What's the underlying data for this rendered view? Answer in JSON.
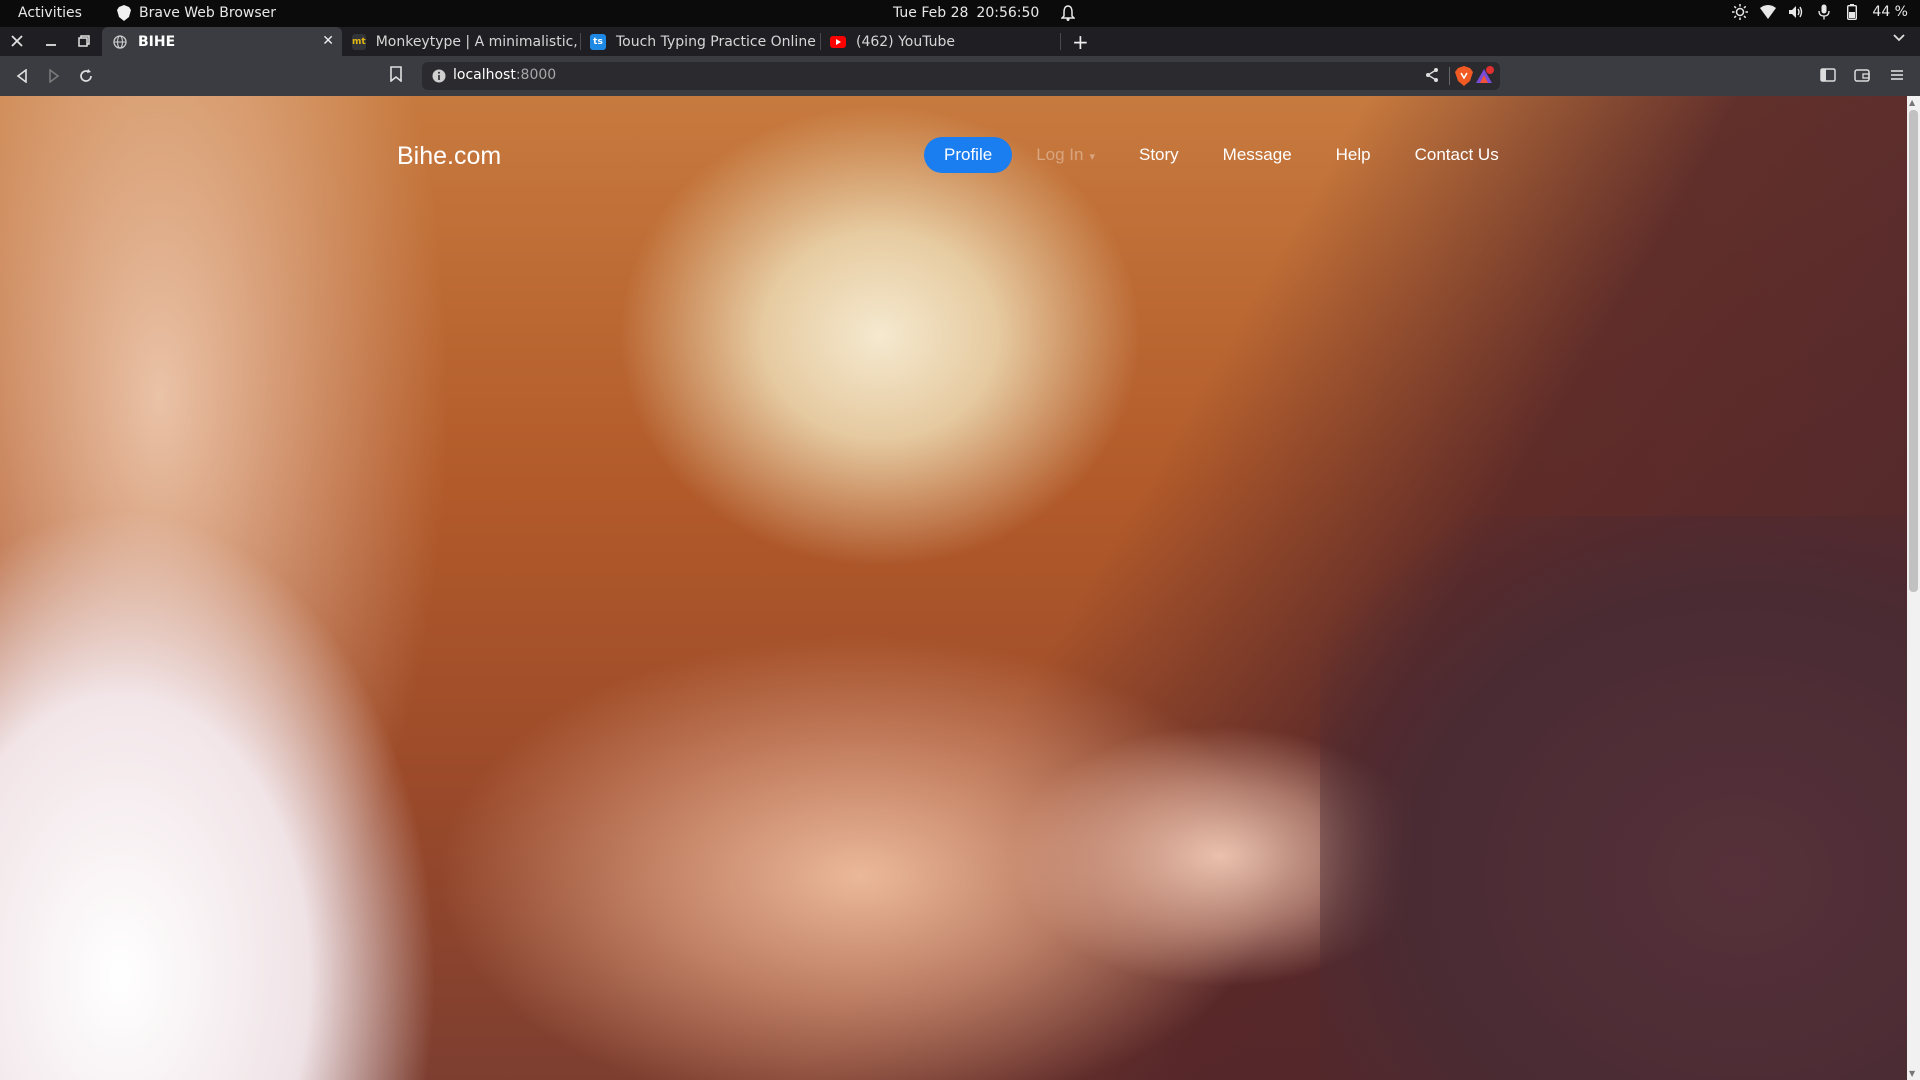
{
  "system": {
    "activities": "Activities",
    "app_name": "Brave Web Browser",
    "date": "Tue Feb 28",
    "time": "20:56:50",
    "battery": "44 %"
  },
  "tabs": [
    {
      "title": "BIHE",
      "active": true,
      "favicon": "globe-icon"
    },
    {
      "title": "Monkeytype | A minimalistic, c",
      "active": false,
      "favicon": "mt"
    },
    {
      "title": "Touch Typing Practice Online",
      "active": false,
      "favicon": "ts"
    },
    {
      "title": "(462) YouTube",
      "active": false,
      "favicon": "youtube-icon"
    }
  ],
  "address": {
    "host": "localhost",
    "port": ":8000"
  },
  "site": {
    "brand": "Bihe.com",
    "nav": [
      {
        "label": "Profile",
        "active": true
      },
      {
        "label": "Log In",
        "dropdown": true
      },
      {
        "label": "Story"
      },
      {
        "label": "Message"
      },
      {
        "label": "Help"
      },
      {
        "label": "Contact Us"
      }
    ]
  },
  "colors": {
    "accent": "#1a7df0",
    "browser_toolbar": "#3b3b42",
    "topbar": "#0b0b0b"
  }
}
